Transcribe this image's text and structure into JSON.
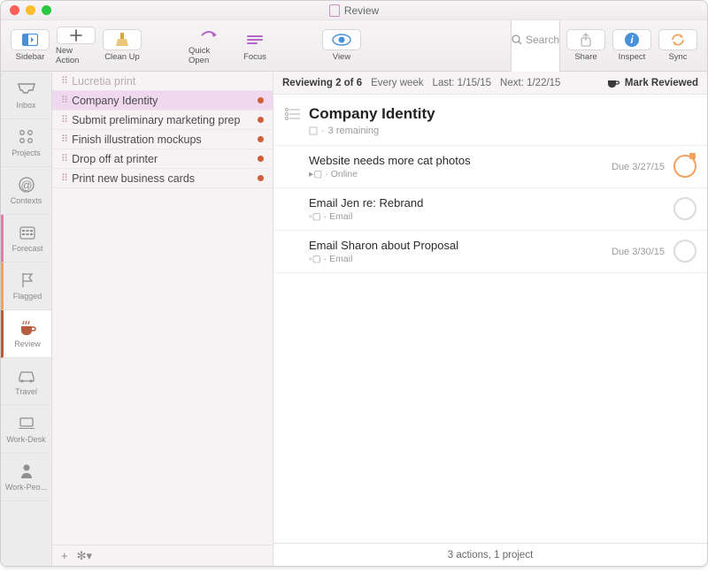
{
  "window": {
    "title": "Review"
  },
  "toolbar": {
    "sidebar": "Sidebar",
    "new_action": "New Action",
    "clean_up": "Clean Up",
    "quick_open": "Quick Open",
    "focus": "Focus",
    "view": "View",
    "search_placeholder": "Search",
    "search_label": "Search",
    "share": "Share",
    "inspect": "Inspect",
    "sync": "Sync"
  },
  "perspectives": [
    {
      "id": "inbox",
      "label": "Inbox"
    },
    {
      "id": "projects",
      "label": "Projects"
    },
    {
      "id": "contexts",
      "label": "Contexts"
    },
    {
      "id": "forecast",
      "label": "Forecast"
    },
    {
      "id": "flagged",
      "label": "Flagged"
    },
    {
      "id": "review",
      "label": "Review"
    },
    {
      "id": "travel",
      "label": "Travel"
    },
    {
      "id": "workdesk",
      "label": "Work-Desk"
    },
    {
      "id": "workpeo",
      "label": "Work-Peo..."
    }
  ],
  "projects": [
    {
      "name": "Lucretia print",
      "dim": true,
      "dot": false,
      "selected": false
    },
    {
      "name": "Company Identity",
      "dim": false,
      "dot": true,
      "selected": true
    },
    {
      "name": "Submit preliminary marketing prep",
      "dim": false,
      "dot": true,
      "selected": false
    },
    {
      "name": "Finish illustration mockups",
      "dim": false,
      "dot": true,
      "selected": false
    },
    {
      "name": "Drop off at printer",
      "dim": false,
      "dot": true,
      "selected": false
    },
    {
      "name": "Print new business cards",
      "dim": false,
      "dot": true,
      "selected": false
    }
  ],
  "status": {
    "reviewing": "Reviewing 2 of 6",
    "frequency": "Every week",
    "last": "Last: 1/15/15",
    "next": "Next: 1/22/15",
    "mark_reviewed": "Mark Reviewed"
  },
  "project_detail": {
    "title": "Company Identity",
    "remaining": "3 remaining"
  },
  "tasks": [
    {
      "title": "Website needs more cat photos",
      "context": "Online",
      "due": "Due 3/27/15",
      "status": "soon"
    },
    {
      "title": "Email Jen re: Rebrand",
      "context": "Email",
      "due": "",
      "status": ""
    },
    {
      "title": "Email Sharon about Proposal",
      "context": "Email",
      "due": "Due 3/30/15",
      "status": ""
    }
  ],
  "footer": {
    "summary": "3 actions, 1 project"
  }
}
